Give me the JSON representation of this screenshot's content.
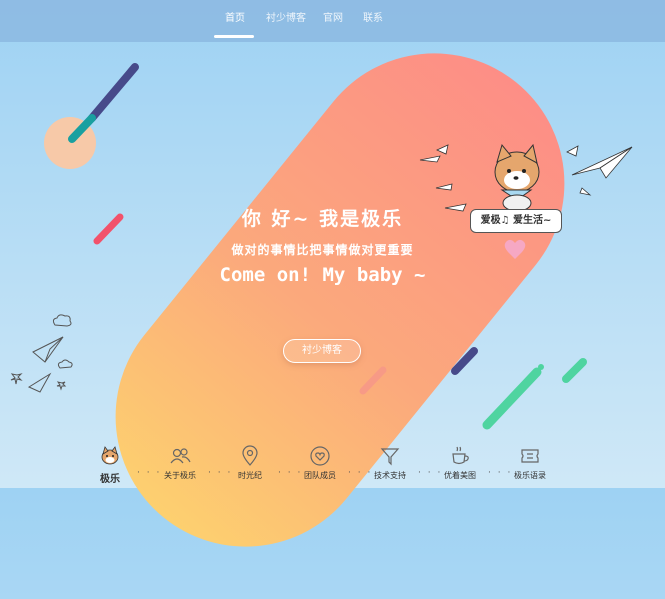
{
  "nav": {
    "items": [
      "首页",
      "衬少博客",
      "官网",
      "联系"
    ],
    "active_index": 0
  },
  "hero": {
    "greeting": "你 好~ 我是极乐",
    "motto": "做对的事情比把事情做对更重要",
    "slogan": "Come on! My baby ~",
    "button_label": "衬少博客"
  },
  "mascot": {
    "speech": "爱极♫ 爱生活~"
  },
  "bottom_nav": {
    "items": [
      {
        "label": "极乐",
        "icon": "dog-avatar-icon"
      },
      {
        "label": "关于极乐",
        "icon": "users-icon"
      },
      {
        "label": "时光纪",
        "icon": "location-pin-icon"
      },
      {
        "label": "团队成员",
        "icon": "heart-circle-icon"
      },
      {
        "label": "技术支持",
        "icon": "funnel-icon"
      },
      {
        "label": "优着美图",
        "icon": "coffee-cup-icon"
      },
      {
        "label": "极乐语录",
        "icon": "ticket-icon"
      }
    ],
    "separator": "· · ·",
    "active_index": 0
  },
  "colors": {
    "sky": "#9ed2f3",
    "slab_top": "#fd8e86",
    "slab_bottom": "#fdd06f",
    "accent_teal": "#19a0a0",
    "accent_navy": "#474a8a",
    "accent_pink": "#f2526b",
    "accent_green": "#4fd4a0"
  }
}
